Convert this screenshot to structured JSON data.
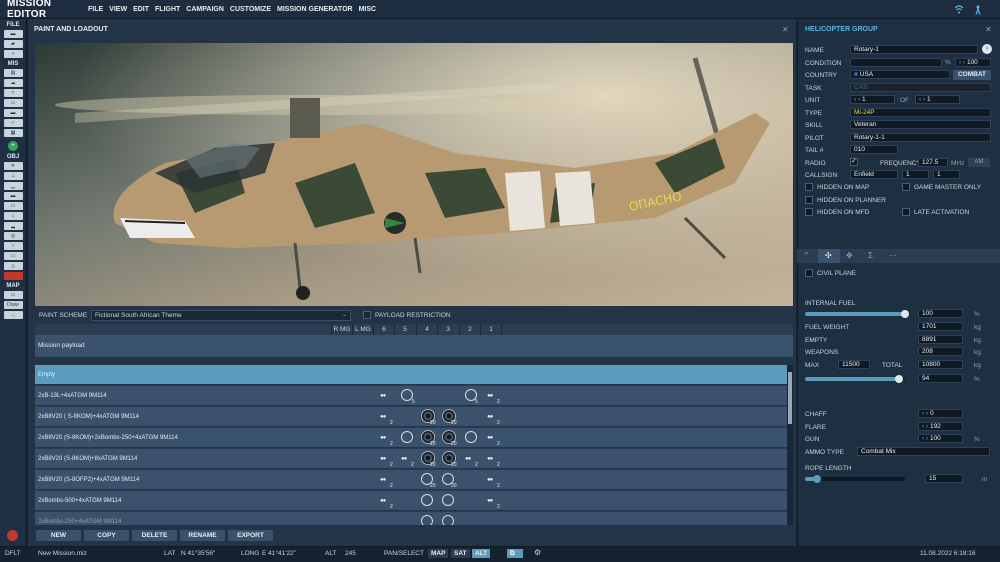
{
  "app": {
    "title": "MISSION EDITOR"
  },
  "menu": [
    "FILE",
    "VIEW",
    "EDIT",
    "FLIGHT",
    "CAMPAIGN",
    "CUSTOMIZE",
    "MISSION GENERATOR",
    "MISC"
  ],
  "toolbar": {
    "file_label": "FILE",
    "mis_label": "MIS",
    "obj_label": "OBJ",
    "map_label": "MAP",
    "draw_label": "Draw"
  },
  "paint": {
    "title": "PAINT AND LOADOUT",
    "scheme_label": "PAINT SCHEME",
    "scheme_value": "Fictional South African Theme",
    "payload_restriction": "PAYLOAD RESTRICTION",
    "aircraft_code": "ОПАСНО",
    "columns": [
      "R MG",
      "L MG",
      "6",
      "5",
      "4",
      "3",
      "2",
      "1"
    ],
    "mission_payload": "Mission payload",
    "rows": [
      {
        "name": "Empty"
      },
      {
        "name": "2xB-13L+4xATGM 9M114"
      },
      {
        "name": "2xB8V20 ( S-8KOM)+4xATGM 9M114"
      },
      {
        "name": "2xB8V20 (S-8KOM)+2xBombs-250+4xATGM 9M114"
      },
      {
        "name": "2xB8V20 (S-8KOM)+8xATGM 9M114"
      },
      {
        "name": "2xB8V20 (S-8OFP2)+4xATGM 9M114"
      },
      {
        "name": "2xBombs-500+4xATGM 9M114"
      },
      {
        "name": "2xBombs-250+4xATGM 9M114"
      }
    ],
    "counts": {
      "c2": "2",
      "c5": "5",
      "c20": "20"
    },
    "buttons": {
      "new": "NEW",
      "copy": "COPY",
      "delete": "DELETE",
      "rename": "RENAME",
      "export": "EXPORT"
    }
  },
  "group": {
    "title": "HELICOPTER GROUP",
    "name_label": "NAME",
    "name_value": "Rotary-1",
    "condition_label": "CONDITION",
    "condition_pct": "%",
    "condition_value": "100",
    "country_label": "COUNTRY",
    "country_value": "USA",
    "combat_button": "COMBAT",
    "task_label": "TASK",
    "task_value": "CAS",
    "unit_label": "UNIT",
    "unit_value": "1",
    "of_label": "OF",
    "of_value": "1",
    "type_label": "TYPE",
    "type_value": "Mi-24P",
    "skill_label": "SKILL",
    "skill_value": "Veteran",
    "pilot_label": "PILOT",
    "pilot_value": "Rotary-1-1",
    "tail_label": "TAIL #",
    "tail_value": "010",
    "radio_label": "RADIO",
    "frequency_label": "FREQUENCY",
    "frequency_value": "127.5",
    "mhz": "MHz",
    "am": "AM",
    "callsign_label": "CALLSIGN",
    "callsign_value": "Enfield",
    "callsign_n1": "1",
    "callsign_n2": "1",
    "hidden_map": "HIDDEN ON MAP",
    "game_master_only": "GAME MASTER ONLY",
    "hidden_planner": "HIDDEN ON PLANNER",
    "hidden_mfd": "HIDDEN ON MFD",
    "late_activation": "LATE ACTIVATION"
  },
  "loadout": {
    "civil_plane": "CIVIL PLANE",
    "internal_fuel_label": "INTERNAL FUEL",
    "internal_fuel_value": "100",
    "internal_fuel_fraction": 1.0,
    "pct": "%",
    "kg": "kg",
    "m": "m",
    "fuel_weight_label": "FUEL WEIGHT",
    "fuel_weight_value": "1701",
    "empty_label": "EMPTY",
    "empty_value": "8891",
    "weapons_label": "WEAPONS",
    "weapons_value": "208",
    "max_label": "MAX",
    "max_value": "11500",
    "total_label": "TOTAL",
    "total_value": "10800",
    "total_pct": "94",
    "total_fraction": 0.94,
    "chaff_label": "CHAFF",
    "chaff_value": "0",
    "flare_label": "FLARE",
    "flare_value": "192",
    "gun_label": "GUN",
    "gun_value": "100",
    "ammo_label": "AMMO TYPE",
    "ammo_value": "Combat Mix",
    "rope_label": "ROPE LENGTH",
    "rope_value": "15",
    "rope_fraction": 0.12
  },
  "status": {
    "mode": "DFLT",
    "mission_file": "New Mission.miz",
    "lat_label": "LAT",
    "lat_value": "N 41°35'56\"",
    "long_label": "LONG",
    "long_value": "E 41°41'22\"",
    "alt_label": "ALT",
    "alt_value": "245",
    "pan_select": "PAN/SELECT",
    "map": "MAP",
    "sat": "SAT",
    "alt_btn": "ALT",
    "datetime": "11.08.2022 6:18:16"
  },
  "colors": {
    "accent": "#5b9bbd",
    "title_blue": "#5ab4e6",
    "bg": "#1b2838"
  }
}
